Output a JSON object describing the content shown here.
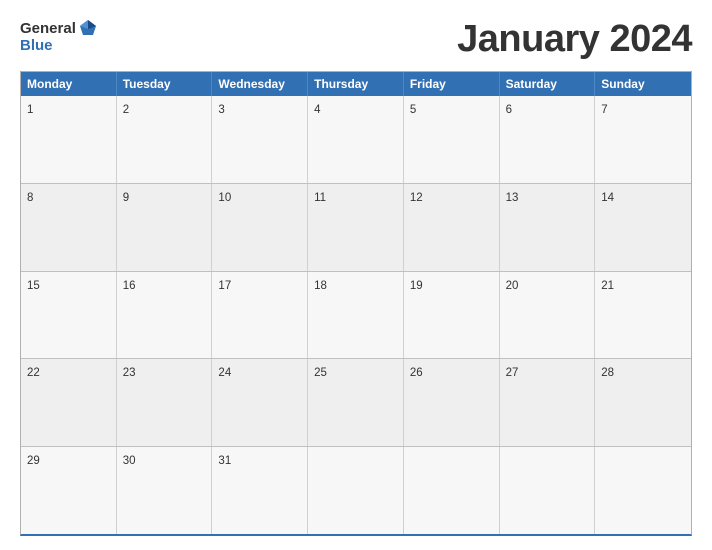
{
  "header": {
    "logo": {
      "general": "General",
      "flag": "🏴",
      "blue": "Blue"
    },
    "title": "January 2024"
  },
  "calendar": {
    "days_of_week": [
      "Monday",
      "Tuesday",
      "Wednesday",
      "Thursday",
      "Friday",
      "Saturday",
      "Sunday"
    ],
    "weeks": [
      [
        {
          "num": "1",
          "empty": false
        },
        {
          "num": "2",
          "empty": false
        },
        {
          "num": "3",
          "empty": false
        },
        {
          "num": "4",
          "empty": false
        },
        {
          "num": "5",
          "empty": false
        },
        {
          "num": "6",
          "empty": false
        },
        {
          "num": "7",
          "empty": false
        }
      ],
      [
        {
          "num": "8",
          "empty": false
        },
        {
          "num": "9",
          "empty": false
        },
        {
          "num": "10",
          "empty": false
        },
        {
          "num": "11",
          "empty": false
        },
        {
          "num": "12",
          "empty": false
        },
        {
          "num": "13",
          "empty": false
        },
        {
          "num": "14",
          "empty": false
        }
      ],
      [
        {
          "num": "15",
          "empty": false
        },
        {
          "num": "16",
          "empty": false
        },
        {
          "num": "17",
          "empty": false
        },
        {
          "num": "18",
          "empty": false
        },
        {
          "num": "19",
          "empty": false
        },
        {
          "num": "20",
          "empty": false
        },
        {
          "num": "21",
          "empty": false
        }
      ],
      [
        {
          "num": "22",
          "empty": false
        },
        {
          "num": "23",
          "empty": false
        },
        {
          "num": "24",
          "empty": false
        },
        {
          "num": "25",
          "empty": false
        },
        {
          "num": "26",
          "empty": false
        },
        {
          "num": "27",
          "empty": false
        },
        {
          "num": "28",
          "empty": false
        }
      ],
      [
        {
          "num": "29",
          "empty": false
        },
        {
          "num": "30",
          "empty": false
        },
        {
          "num": "31",
          "empty": false
        },
        {
          "num": "",
          "empty": true
        },
        {
          "num": "",
          "empty": true
        },
        {
          "num": "",
          "empty": true
        },
        {
          "num": "",
          "empty": true
        }
      ]
    ]
  }
}
